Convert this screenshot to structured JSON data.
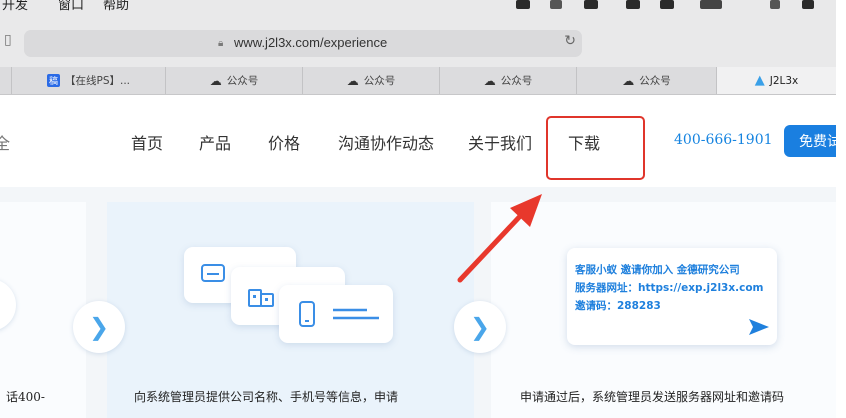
{
  "menubar": {
    "items": [
      "开发",
      "窗口",
      "帮助"
    ]
  },
  "browser": {
    "url": "www.j2l3x.com/experience",
    "tabs": [
      {
        "label": "【在线PS】...",
        "icon": "gaoding-icon"
      },
      {
        "label": "公众号",
        "icon": "wechat-icon"
      },
      {
        "label": "公众号",
        "icon": "wechat-icon"
      },
      {
        "label": "公众号",
        "icon": "wechat-icon"
      },
      {
        "label": "公众号",
        "icon": "wechat-icon"
      },
      {
        "label": "J2L3x",
        "icon": "j2l3x-logo-icon"
      }
    ]
  },
  "nav": {
    "items": [
      "首页",
      "产品",
      "价格",
      "沟通协作动态",
      "关于我们",
      "下载"
    ],
    "phone": "400-666-1901",
    "cta": "免费试",
    "left_fragment": "全"
  },
  "content": {
    "captions": [
      "话400-",
      "向系统管理员提供公司名称、手机号等信息，申请",
      "申请通过后，系统管理员发送服务器网址和邀请码"
    ],
    "invite": {
      "line1": "客服小蚁 邀请你加入 金德研究公司",
      "line2": "服务器网址：https://exp.j2l3x.com",
      "line3": "邀请码：288283"
    }
  },
  "colors": {
    "accent": "#1a7fe0",
    "highlight": "#e0352b"
  }
}
